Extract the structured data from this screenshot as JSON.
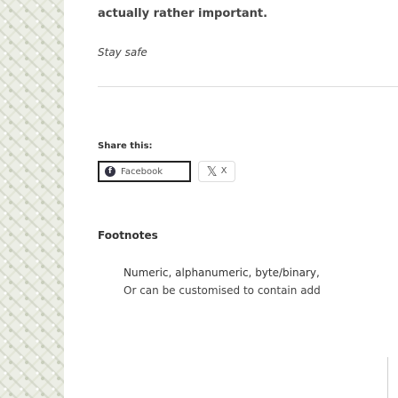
{
  "article": {
    "intro_text": "actually rather important.",
    "signoff": "Stay safe"
  },
  "share": {
    "title": "Share this:",
    "facebook_label": "Facebook",
    "x_label": "X"
  },
  "footnotes": {
    "heading": "Footnotes",
    "items": [
      "Numeric, alphanumeric, byte/binary,",
      "Or can be customised to contain add"
    ]
  }
}
